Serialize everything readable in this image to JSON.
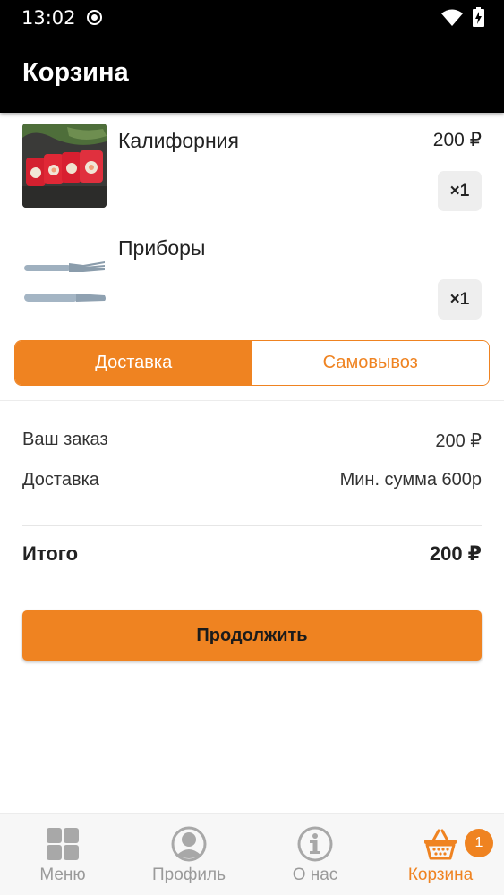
{
  "status": {
    "time": "13:02"
  },
  "appbar": {
    "title": "Корзина"
  },
  "cart": {
    "items": [
      {
        "name": "Калифорния",
        "price": "200 ₽",
        "qty": "×1",
        "image": "sushi-roll-photo"
      },
      {
        "name": "Приборы",
        "price": "",
        "qty": "×1",
        "image": "cutlery-photo"
      }
    ]
  },
  "delivery_toggle": {
    "options": [
      "Доставка",
      "Самовывоз"
    ],
    "selected": "Доставка"
  },
  "summary": {
    "order_label": "Ваш заказ",
    "order_value": "200 ₽",
    "delivery_label": "Доставка",
    "delivery_value": "Мин. сумма 600р",
    "total_label": "Итого",
    "total_value": "200 ₽"
  },
  "continue_button": {
    "label": "Продолжить"
  },
  "bottom_nav": {
    "items": [
      {
        "label": "Меню",
        "icon": "grid-icon"
      },
      {
        "label": "Профиль",
        "icon": "profile-icon"
      },
      {
        "label": "О нас",
        "icon": "info-icon"
      },
      {
        "label": "Корзина",
        "icon": "basket-icon",
        "badge": "1",
        "active": true
      }
    ]
  },
  "colors": {
    "accent": "#ef8321",
    "appbar": "#000000",
    "inactive_nav": "#9a9a9a"
  }
}
